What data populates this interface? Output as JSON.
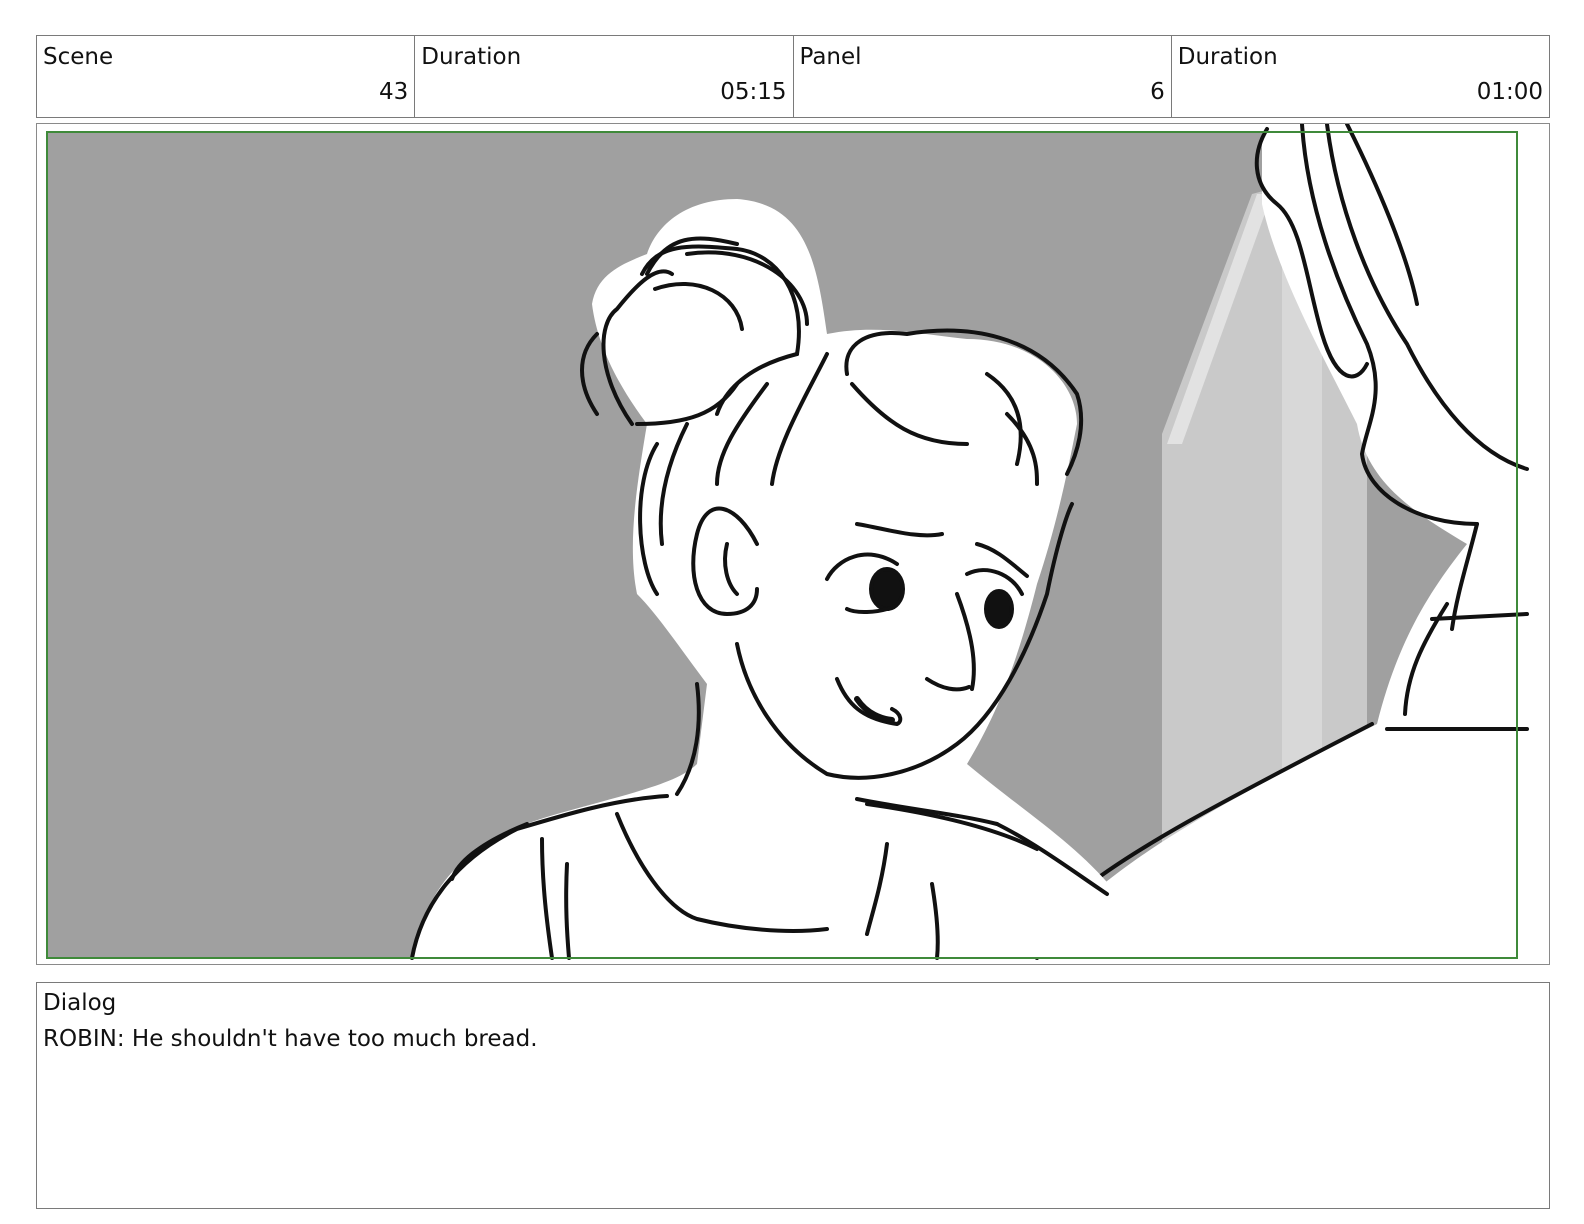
{
  "header": {
    "fields": [
      {
        "label": "Scene",
        "value": "43"
      },
      {
        "label": "Duration",
        "value": "05:15"
      },
      {
        "label": "Panel",
        "value": "6"
      },
      {
        "label": "Duration",
        "value": "01:00"
      }
    ]
  },
  "dialog": {
    "label": "Dialog",
    "text": "ROBIN: He shouldn't have too much bread."
  },
  "colors": {
    "safe_area_border": "#3f8a3a",
    "background_gray": "#a0a0a0",
    "panel_border": "#8a8a8a"
  }
}
